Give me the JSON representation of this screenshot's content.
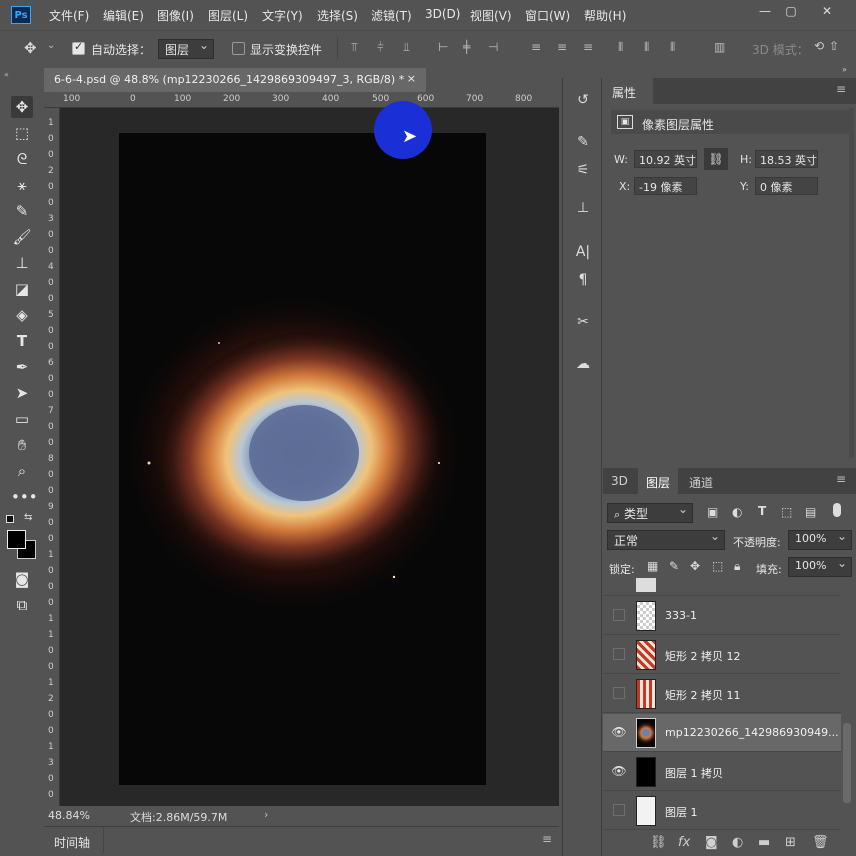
{
  "app": {
    "logo": "Ps"
  },
  "menu": [
    "文件(F)",
    "编辑(E)",
    "图像(I)",
    "图层(L)",
    "文字(Y)",
    "选择(S)",
    "滤镜(T)",
    "3D(D)",
    "视图(V)",
    "窗口(W)",
    "帮助(H)"
  ],
  "window_controls": {
    "minimize": "—",
    "restore": "▢",
    "close": "✕"
  },
  "options": {
    "auto_select_label": "自动选择：",
    "auto_select_checked": true,
    "target_value": "图层",
    "show_transform_label": "显示变换控件",
    "show_transform_checked": false,
    "mode_3d_label": "3D 模式："
  },
  "document": {
    "tab_title": "6-6-4.psd @ 48.8% (mp12230266_1429869309497_3, RGB/8) *",
    "close": "×",
    "ruler_top": [
      "100",
      "0",
      "100",
      "200",
      "300",
      "400",
      "500",
      "600",
      "700",
      "800"
    ],
    "ruler_left": [
      "1",
      "0",
      "0",
      "2",
      "0",
      "0",
      "3",
      "0",
      "0",
      "4",
      "0",
      "0",
      "5",
      "0",
      "0",
      "6",
      "0",
      "0",
      "7",
      "0",
      "0",
      "8",
      "0",
      "0",
      "9",
      "0",
      "0",
      "1",
      "0",
      "0",
      "0",
      "1",
      "1",
      "0",
      "0",
      "1",
      "2",
      "0",
      "0",
      "1",
      "3",
      "0",
      "0"
    ],
    "zoom": "48.84%",
    "doc_size": "文档:2.86M/59.7M"
  },
  "timeline": {
    "label": "时间轴"
  },
  "properties": {
    "tab": "属性",
    "section": "像素图层属性",
    "w_label": "W:",
    "w_value": "10.92 英寸",
    "h_label": "H:",
    "h_value": "18.53 英寸",
    "x_label": "X:",
    "x_value": "-19 像素",
    "y_label": "Y:",
    "y_value": "0 像素"
  },
  "layers_panel": {
    "tabs": [
      "3D",
      "图层",
      "通道"
    ],
    "active_tab": "图层",
    "filter": "类型",
    "blend_mode": "正常",
    "opacity_label": "不透明度:",
    "opacity": "100%",
    "lock_label": "锁定:",
    "fill_label": "填充:",
    "fill": "100%",
    "layers": [
      {
        "name": "333-1",
        "visible": false
      },
      {
        "name": "矩形 2 拷贝 12",
        "visible": false
      },
      {
        "name": "矩形 2 拷贝 11",
        "visible": false
      },
      {
        "name": "mp12230266_142986930949...",
        "visible": true,
        "selected": true
      },
      {
        "name": "图层 1 拷贝",
        "visible": true
      },
      {
        "name": "图层 1",
        "visible": false
      }
    ]
  },
  "colors": {
    "accent": "#31a8ff",
    "cursor_highlight": "#1a2fd6",
    "selected_row": "#686868",
    "panel": "#535353"
  }
}
